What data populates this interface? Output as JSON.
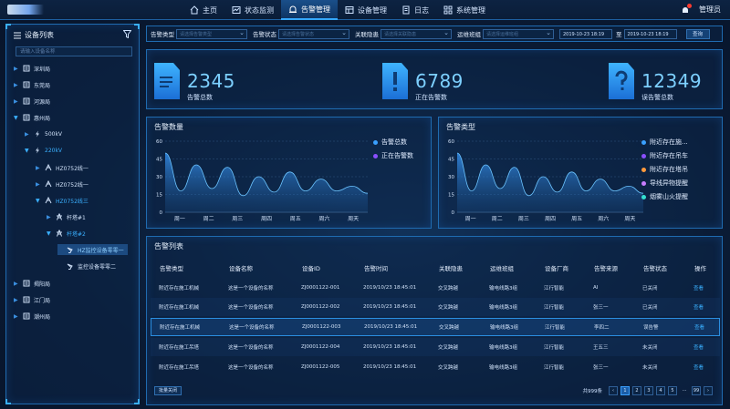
{
  "nav": {
    "items": [
      {
        "label": "主页",
        "icon": "home-icon"
      },
      {
        "label": "状态监测",
        "icon": "monitor-icon"
      },
      {
        "label": "告警管理",
        "icon": "alarm-icon",
        "active": true
      },
      {
        "label": "设备管理",
        "icon": "device-icon"
      },
      {
        "label": "日志",
        "icon": "log-icon"
      },
      {
        "label": "系统管理",
        "icon": "system-icon"
      }
    ],
    "user": "管理员"
  },
  "sidebar": {
    "title": "设备列表",
    "search_placeholder": "请输入设备名称",
    "tree": [
      {
        "label": "深圳局",
        "depth": 0,
        "type": "bureau"
      },
      {
        "label": "东莞局",
        "depth": 0,
        "type": "bureau"
      },
      {
        "label": "河源局",
        "depth": 0,
        "type": "bureau"
      },
      {
        "label": "惠州局",
        "depth": 0,
        "type": "bureau",
        "open": true
      },
      {
        "label": "500kV",
        "depth": 1,
        "type": "voltage"
      },
      {
        "label": "220kV",
        "depth": 1,
        "type": "voltage",
        "open": true
      },
      {
        "label": "HZ0752线一",
        "depth": 2,
        "type": "line"
      },
      {
        "label": "HZ0752线一",
        "depth": 2,
        "type": "line"
      },
      {
        "label": "HZ0752线三",
        "depth": 2,
        "type": "line",
        "open": true
      },
      {
        "label": "杆塔#1",
        "depth": 3,
        "type": "tower"
      },
      {
        "label": "杆塔#2",
        "depth": 3,
        "type": "tower",
        "open": true
      },
      {
        "label": "HZ监控设备零零一",
        "depth": 4,
        "type": "camera",
        "selected": true
      },
      {
        "label": "监控设备零零二",
        "depth": 4,
        "type": "camera"
      },
      {
        "label": "揭阳局",
        "depth": 0,
        "type": "bureau"
      },
      {
        "label": "江门局",
        "depth": 0,
        "type": "bureau"
      },
      {
        "label": "潮州局",
        "depth": 0,
        "type": "bureau"
      }
    ]
  },
  "filters": {
    "alarm_type": {
      "label": "告警类型",
      "placeholder": "请选择告警类型"
    },
    "alarm_status": {
      "label": "告警状态",
      "placeholder": "请选择告警状态"
    },
    "hazard": {
      "label": "关联隐患",
      "placeholder": "请选择关联隐患"
    },
    "team": {
      "label": "运维班组",
      "placeholder": "请选择运维班组"
    },
    "date_from": "2019-10-23 18:19",
    "date_sep": "至",
    "date_to": "2019-10-23 18:19",
    "query": "查询"
  },
  "stats": [
    {
      "value": "2345",
      "label": "告警总数",
      "icon": "document-alarm-icon"
    },
    {
      "value": "6789",
      "label": "正在告警数",
      "icon": "exclamation-icon"
    },
    {
      "value": "12349",
      "label": "误告警总数",
      "icon": "question-icon"
    }
  ],
  "charts": {
    "count": {
      "title": "告警数量",
      "legend": [
        "告警总数",
        "正在告警数"
      ]
    },
    "type": {
      "title": "告警类型",
      "legend": [
        "附近存在施...",
        "附近存在吊车",
        "附近存在塔吊",
        "导线异物提醒",
        "烟雾山火提醒"
      ]
    }
  },
  "chart_data": [
    {
      "type": "area",
      "title": "告警数量",
      "categories": [
        "周一",
        "周二",
        "周三",
        "周四",
        "周五",
        "周六",
        "周天"
      ],
      "yticks": [
        0,
        15,
        30,
        45,
        60
      ],
      "ylim": [
        0,
        60
      ],
      "series": [
        {
          "name": "告警总数",
          "values": [
            50,
            18,
            40,
            20,
            38,
            14,
            30,
            17,
            34,
            18,
            28,
            18,
            22,
            16
          ]
        }
      ],
      "legend_position": "right"
    },
    {
      "type": "area",
      "title": "告警类型",
      "categories": [
        "周一",
        "周二",
        "周三",
        "周四",
        "周五",
        "周六",
        "周天"
      ],
      "yticks": [
        0,
        15,
        30,
        45,
        60
      ],
      "ylim": [
        0,
        60
      ],
      "series": [
        {
          "name": "附近存在施...",
          "values": [
            50,
            18,
            40,
            20,
            38,
            14,
            30,
            17,
            34,
            18,
            28,
            18,
            22,
            16
          ]
        }
      ],
      "legend_position": "right"
    }
  ],
  "table": {
    "title": "告警列表",
    "columns": [
      "告警类型",
      "设备名称",
      "设备ID",
      "告警时间",
      "关联隐患",
      "运维班组",
      "设备厂商",
      "告警来源",
      "告警状态",
      "操作"
    ],
    "rows": [
      [
        "附近存在施工机械",
        "这是一个设备的名称",
        "ZJ0001122-001",
        "2019/10/23 18:45:01",
        "交叉跨越",
        "输电线路3组",
        "江行智能",
        "AI",
        "已关闭",
        "查看"
      ],
      [
        "附近存在施工机械",
        "这是一个设备的名称",
        "ZJ0001122-002",
        "2019/10/23 18:45:01",
        "交叉跨越",
        "输电线路3组",
        "江行智能",
        "张三一",
        "已关闭",
        "查看"
      ],
      [
        "附近存在施工机械",
        "这是一个设备的名称",
        "ZJ0001122-003",
        "2019/10/23 18:45:01",
        "交叉跨越",
        "输电线路3组",
        "江行智能",
        "李四二",
        "误告警",
        "查看"
      ],
      [
        "附近存在施工吊塔",
        "这是一个设备的名称",
        "ZJ0001122-004",
        "2019/10/23 18:45:01",
        "交叉跨越",
        "输电线路3组",
        "江行智能",
        "王五三",
        "未关闭",
        "查看"
      ],
      [
        "附近存在施工吊塔",
        "这是一个设备的名称",
        "ZJ0001122-005",
        "2019/10/23 18:45:01",
        "交叉跨越",
        "输电线路3组",
        "江行智能",
        "张三一",
        "未关闭",
        "查看"
      ]
    ],
    "close_all": "批量关闭",
    "total": "共999条",
    "pages": [
      "1",
      "2",
      "3",
      "4",
      "5",
      "...",
      "99"
    ],
    "current_page": "1"
  },
  "colors": {
    "accent": "#3ab0ff",
    "legend": [
      "#3aa0ff",
      "#8a4fff",
      "#ff9a3c",
      "#c77dff",
      "#34e0d0"
    ]
  }
}
